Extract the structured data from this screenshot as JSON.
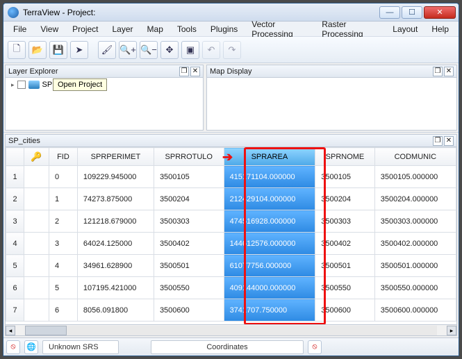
{
  "window": {
    "title": "TerraView - Project:"
  },
  "menu": [
    "File",
    "View",
    "Project",
    "Layer",
    "Map",
    "Tools",
    "Plugins",
    "Vector Processing",
    "Raster Processing",
    "Layout",
    "Help"
  ],
  "toolbar_icons": {
    "new": "🗋",
    "open": "📂",
    "save": "💾",
    "pointer": "➤",
    "brush": "🖌",
    "zoomin": "🔍+",
    "zoomout": "🔍−",
    "pan": "✥",
    "extent": "▣",
    "undo": "↶",
    "redo": "↷"
  },
  "panels": {
    "layer_explorer": {
      "title": "Layer Explorer",
      "node_label": "SP",
      "tooltip": "Open Project"
    },
    "map_display": {
      "title": "Map Display"
    },
    "table": {
      "title": "SP_cities"
    }
  },
  "table": {
    "key_icon": "🔑",
    "columns": [
      "FID",
      "SPRPERIMET",
      "SPRROTULO",
      "SPRAREA",
      "SPRNOME",
      "CODMUNIC"
    ],
    "highlight_col": "SPRAREA",
    "rows": [
      {
        "n": "1",
        "FID": "0",
        "SPRPERIMET": "109229.945000",
        "SPRROTULO": "3500105",
        "SPRAREA": "415171104.000000",
        "SPRNOME": "3500105",
        "CODMUNIC": "3500105.000000"
      },
      {
        "n": "2",
        "FID": "1",
        "SPRPERIMET": "74273.875000",
        "SPRROTULO": "3500204",
        "SPRAREA": "212429104.000000",
        "SPRNOME": "3500204",
        "CODMUNIC": "3500204.000000"
      },
      {
        "n": "3",
        "FID": "2",
        "SPRPERIMET": "121218.679000",
        "SPRROTULO": "3500303",
        "SPRAREA": "474516928.000000",
        "SPRNOME": "3500303",
        "CODMUNIC": "3500303.000000"
      },
      {
        "n": "4",
        "FID": "3",
        "SPRPERIMET": "64024.125000",
        "SPRROTULO": "3500402",
        "SPRAREA": "144612576.000000",
        "SPRNOME": "3500402",
        "CODMUNIC": "3500402.000000"
      },
      {
        "n": "5",
        "FID": "4",
        "SPRPERIMET": "34961.628900",
        "SPRROTULO": "3500501",
        "SPRAREA": "61077756.000000",
        "SPRNOME": "3500501",
        "CODMUNIC": "3500501.000000"
      },
      {
        "n": "6",
        "FID": "5",
        "SPRPERIMET": "107195.421000",
        "SPRROTULO": "3500550",
        "SPRAREA": "409144000.000000",
        "SPRNOME": "3500550",
        "CODMUNIC": "3500550.000000"
      },
      {
        "n": "7",
        "FID": "6",
        "SPRPERIMET": "8056.091800",
        "SPRROTULO": "3500600",
        "SPRAREA": "3741707.750000",
        "SPRNOME": "3500600",
        "CODMUNIC": "3500600.000000"
      }
    ]
  },
  "status": {
    "srs": "Unknown SRS",
    "coord_label": "Coordinates"
  },
  "winbtns": {
    "min": "—",
    "max": "☐",
    "close": "✕"
  }
}
